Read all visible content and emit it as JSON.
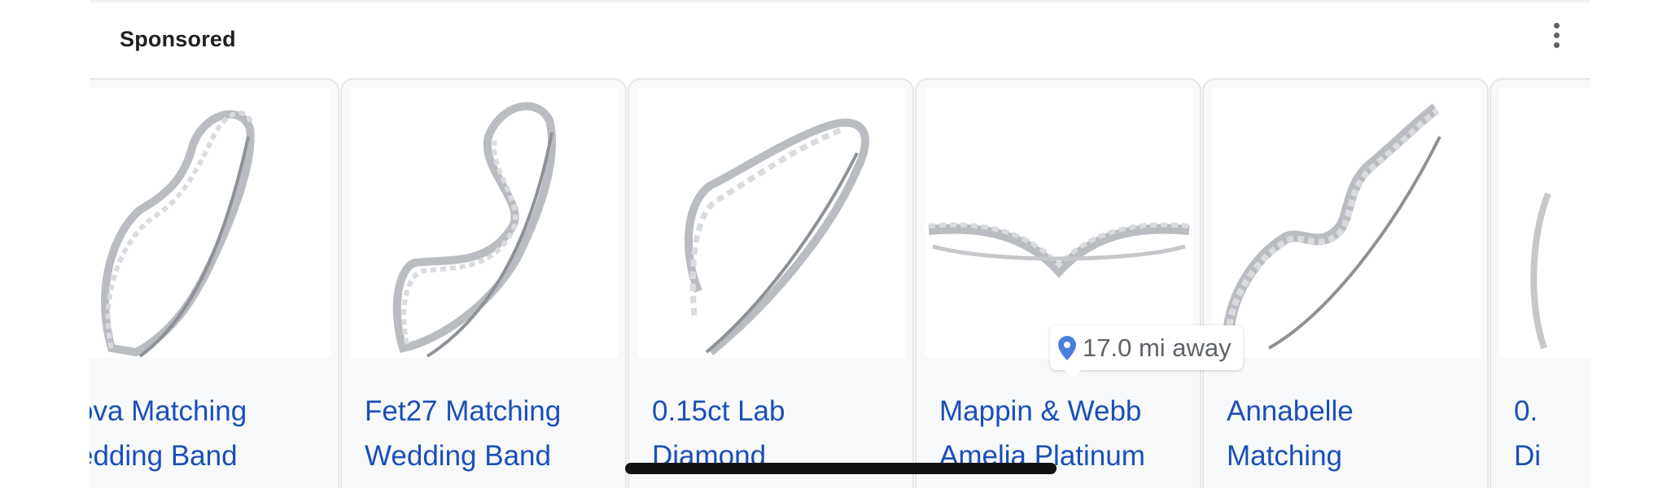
{
  "header": {
    "label": "Sponsored",
    "menu_icon": "more-vert-icon"
  },
  "products": [
    {
      "title_line1": "ova Matching",
      "title_line2": "edding Band",
      "image": "curved-diamond-wedding-band-image"
    },
    {
      "title_line1": "Fet27 Matching",
      "title_line2": "Wedding Band",
      "image": "wishbone-diamond-wedding-band-image"
    },
    {
      "title_line1": "0.15ct Lab",
      "title_line2": "Diamond",
      "image": "v-shaped-lab-diamond-band-image"
    },
    {
      "title_line1": "Mappin & Webb",
      "title_line2": "Amelia Platinum",
      "image": "platinum-v-band-image"
    },
    {
      "title_line1": "Annabelle",
      "title_line2": "Matching",
      "image": "stepped-diamond-wedding-band-image"
    },
    {
      "title_line1": "0.",
      "title_line2": "Di",
      "image": "partial-ring-image"
    }
  ],
  "distance_badge": {
    "text": "17.0 mi away",
    "icon": "location-pin-icon",
    "color": "#4a7fe0"
  },
  "colors": {
    "link": "#1a4fb8",
    "card_bg": "#f8f9fa"
  }
}
